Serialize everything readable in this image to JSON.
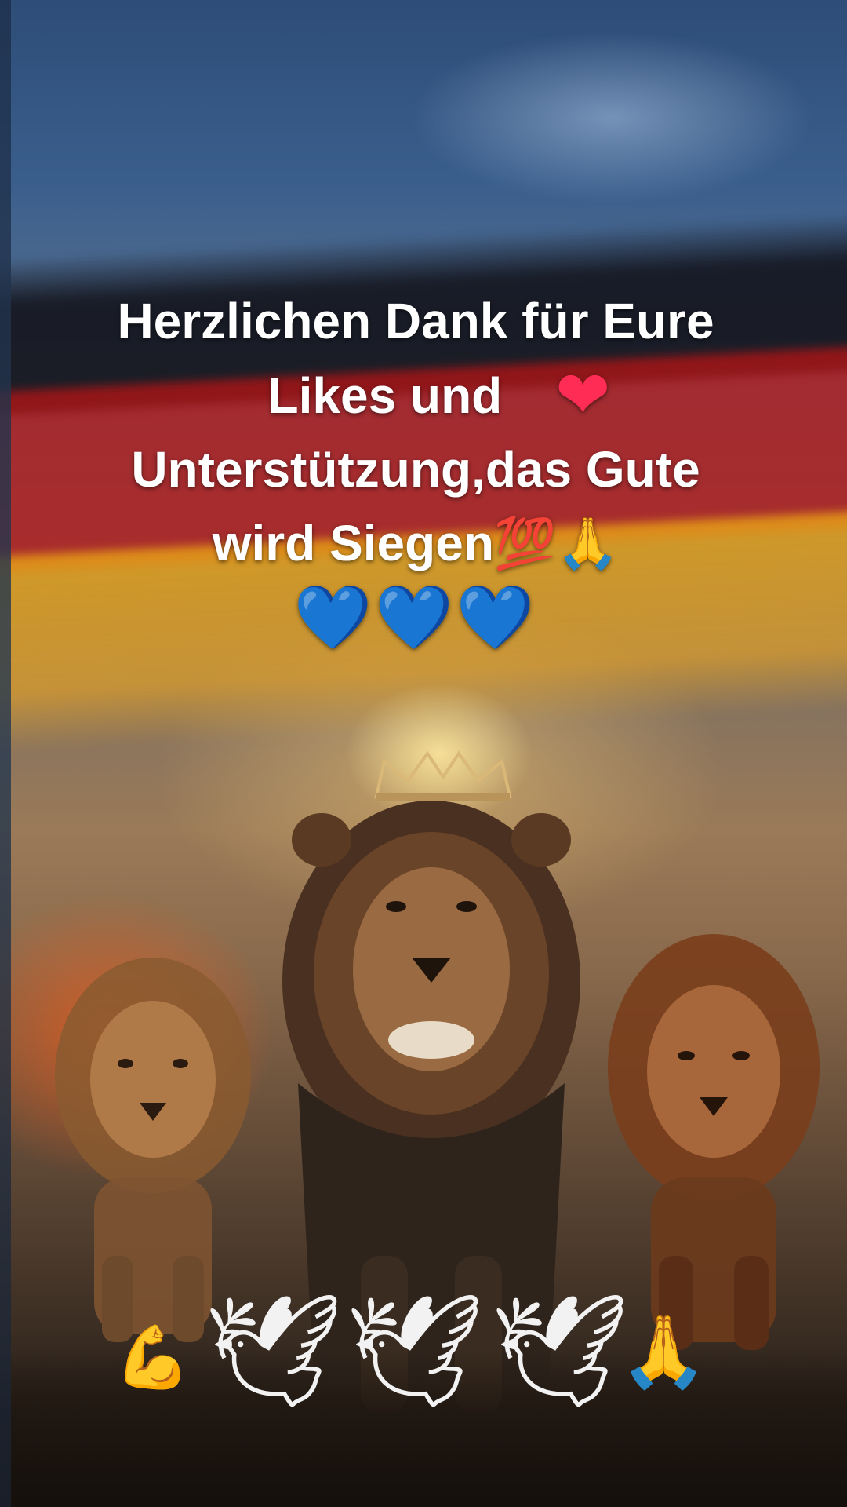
{
  "caption": {
    "line1": "Herzlichen Dank für Eure",
    "line2": "Likes und",
    "line2_emoji": "❤",
    "line3": "Unterstützung,das Gute",
    "line4": "wird Siegen",
    "line4_emoji": "💯🙏",
    "line5": "💙💙💙"
  },
  "bottom_emojis": {
    "strong": "💪",
    "dove": "🕊",
    "pray": "🙏"
  },
  "colors": {
    "flag_black": "#0f0f16",
    "flag_red": "#be1414",
    "flag_gold": "#eba514",
    "caption_text": "#ffffff",
    "blue_heart": "#2ea8ff",
    "red_heart": "#ff2d55"
  }
}
